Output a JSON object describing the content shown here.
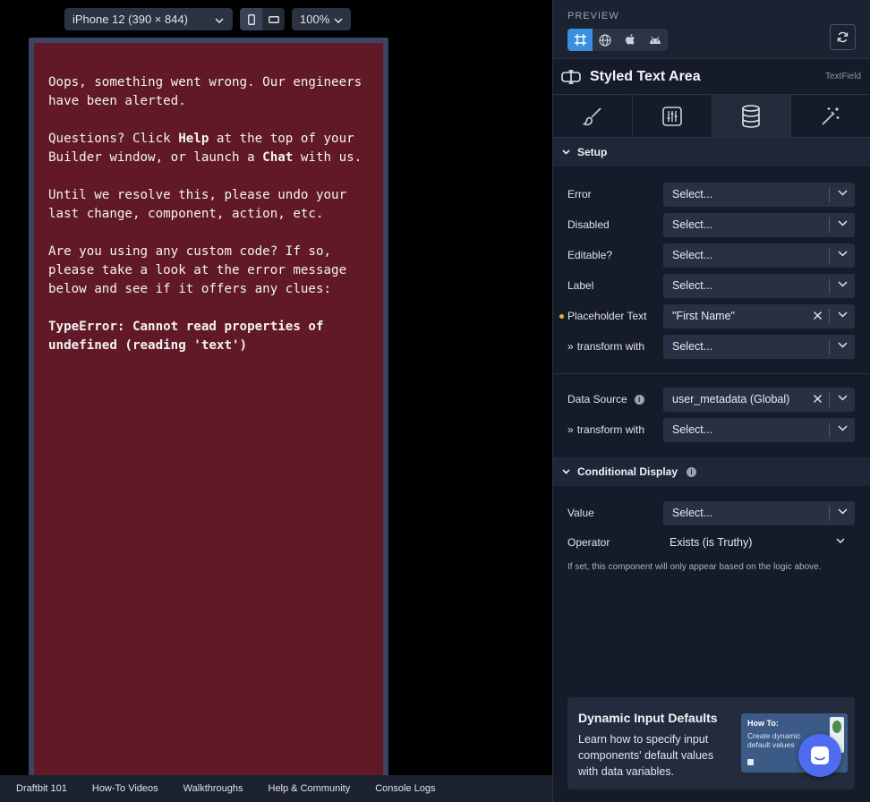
{
  "toolbar": {
    "device": "iPhone 12 (390 × 844)",
    "zoom": "100%"
  },
  "error_screen": {
    "line1": "Oops, something went wrong. Our engineers have been alerted.",
    "line2_pre": "Questions? Click ",
    "line2_help": "Help",
    "line2_mid": " at the top of your Builder window, or launch a ",
    "line2_chat": "Chat",
    "line2_post": " with us.",
    "line3": "Until we resolve this, please undo your last change, component, action, etc.",
    "line4": "Are you using any custom code? If so, please take a look at the error message below and see if it offers any clues:",
    "error": "TypeError: Cannot read properties of undefined (reading 'text')"
  },
  "bottom_bar": [
    "Draftbit 101",
    "How-To Videos",
    "Walkthroughs",
    "Help & Community",
    "Console Logs"
  ],
  "panel": {
    "preview_label": "PREVIEW",
    "component_title": "Styled Text Area",
    "component_type": "TextField",
    "setup_title": "Setup",
    "rows": {
      "error": {
        "label": "Error",
        "value": "Select..."
      },
      "disabled": {
        "label": "Disabled",
        "value": "Select..."
      },
      "editable": {
        "label": "Editable?",
        "value": "Select..."
      },
      "label": {
        "label": "Label",
        "value": "Select..."
      },
      "placeholder": {
        "label": "Placeholder Text",
        "value": "\"First Name\""
      },
      "transform1": {
        "label": "transform with",
        "value": "Select..."
      },
      "datasource": {
        "label": "Data Source",
        "value": "user_metadata (Global)"
      },
      "transform2": {
        "label": "transform with",
        "value": "Select..."
      },
      "cond_value": {
        "label": "Value",
        "value": "Select..."
      },
      "operator": {
        "label": "Operator",
        "value": "Exists (is Truthy)"
      }
    },
    "conditional_title": "Conditional Display",
    "hint": "If set, this component will only appear based on the logic above.",
    "promo": {
      "title": "Dynamic Input Defaults",
      "body": "Learn how to specify input components' default values with data variables.",
      "thumb_title": "How To:",
      "thumb_sub": "Create dynamic default values"
    }
  }
}
